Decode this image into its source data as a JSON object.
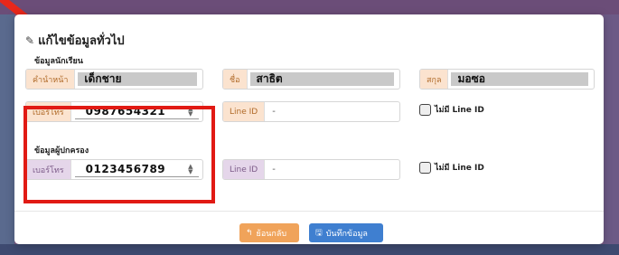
{
  "modal": {
    "title": "แก้ไขข้อมูลทั่วไป",
    "title_icon": "edit-icon"
  },
  "student": {
    "section_label": "ข้อมูลนักเรียน",
    "prefix_label": "คำนำหน้า",
    "prefix_value": "เด็กชาย",
    "firstname_label": "ชื่อ",
    "firstname_value": "สาธิต",
    "lastname_label": "สกุล",
    "lastname_value": "มอซอ",
    "phone_label": "เบอร์โทร",
    "phone_value": "0987654321",
    "lineid_label": "Line ID",
    "lineid_value": "-",
    "no_lineid_label": "ไม่มี Line ID"
  },
  "guardian": {
    "section_label": "ข้อมูลผู้ปกครอง",
    "phone_label": "เบอร์โทร",
    "phone_value": "0123456789",
    "lineid_label": "Line ID",
    "lineid_value": "-",
    "no_lineid_label": "ไม่มี Line ID"
  },
  "buttons": {
    "back_label": "ย้อนกลับ",
    "back_icon": "reply-arrow-icon",
    "save_label": "บันทึกข้อมูล",
    "save_icon": "floppy-disk-icon"
  },
  "colors": {
    "highlight": "#e11a14",
    "orange_addon": "#fbe3cf",
    "purple_addon": "#e5d6ea",
    "back_button": "#f0a35a",
    "save_button": "#3f7fd0"
  }
}
